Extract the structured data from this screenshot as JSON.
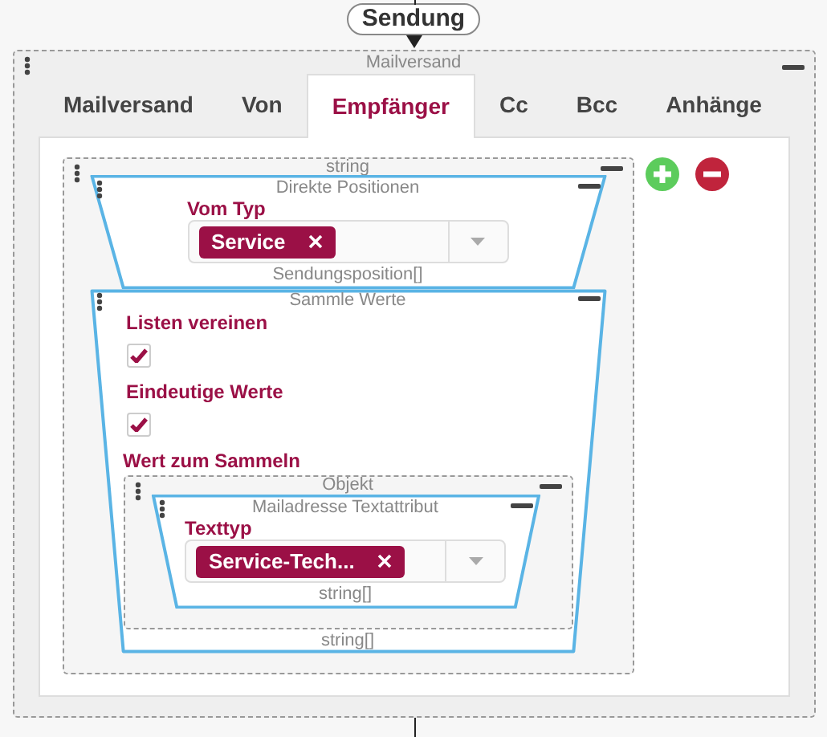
{
  "top_node": {
    "label": "Sendung"
  },
  "panel": {
    "title": "Mailversand",
    "tabs": [
      {
        "label": "Mailversand",
        "selected": false
      },
      {
        "label": "Von",
        "selected": false
      },
      {
        "label": "Empfänger",
        "selected": true
      },
      {
        "label": "Cc",
        "selected": false
      },
      {
        "label": "Bcc",
        "selected": false
      },
      {
        "label": "Anhänge",
        "selected": false
      }
    ],
    "group": {
      "title": "string",
      "nodes": [
        {
          "kind": "funnel",
          "title": "Direkte Positionen",
          "footer": "Sendungsposition[]",
          "fields": [
            {
              "kind": "select",
              "label": "Vom Typ",
              "tags": [
                "Service"
              ]
            }
          ]
        },
        {
          "kind": "funnel",
          "title": "Sammle Werte",
          "footer": "string[]",
          "fields": [
            {
              "kind": "checkbox",
              "label": "Listen vereinen",
              "checked": true
            },
            {
              "kind": "checkbox",
              "label": "Eindeutige Werte",
              "checked": true
            },
            {
              "kind": "nested",
              "label": "Wert zum Sammeln",
              "box": {
                "title": "Objekt",
                "nodes": [
                  {
                    "kind": "funnel",
                    "title": "Mailadresse Textattribut",
                    "footer": "string[]",
                    "fields": [
                      {
                        "kind": "select",
                        "label": "Texttyp",
                        "tags": [
                          "Service-Tech..."
                        ]
                      }
                    ]
                  }
                ]
              }
            }
          ]
        }
      ]
    }
  }
}
